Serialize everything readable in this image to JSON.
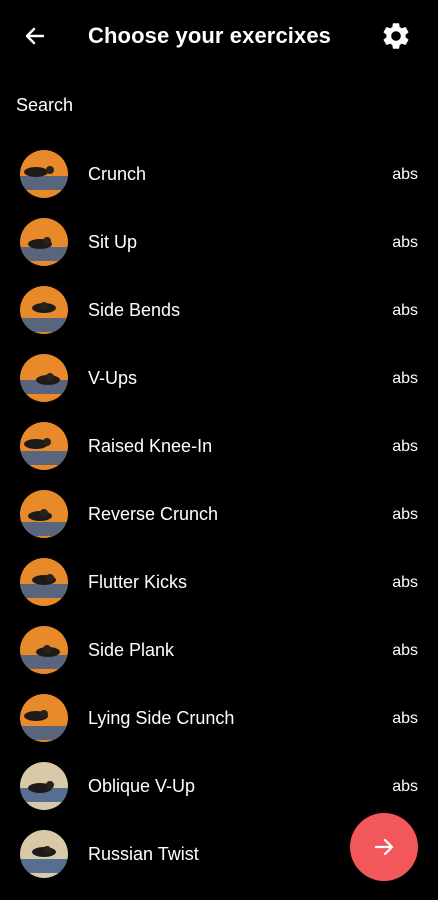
{
  "header": {
    "title": "Choose your exercixes",
    "back_icon": "arrow-left-icon",
    "settings_icon": "gear-icon"
  },
  "search": {
    "label": "Search"
  },
  "exercises": [
    {
      "name": "Crunch",
      "category": "abs",
      "thumb": "warm"
    },
    {
      "name": "Sit Up",
      "category": "abs",
      "thumb": "warm"
    },
    {
      "name": "Side Bends",
      "category": "abs",
      "thumb": "warm"
    },
    {
      "name": "V-Ups",
      "category": "abs",
      "thumb": "warm"
    },
    {
      "name": "Raised Knee-In",
      "category": "abs",
      "thumb": "warm"
    },
    {
      "name": "Reverse Crunch",
      "category": "abs",
      "thumb": "warm"
    },
    {
      "name": "Flutter Kicks",
      "category": "abs",
      "thumb": "warm"
    },
    {
      "name": "Side Plank",
      "category": "abs",
      "thumb": "warm"
    },
    {
      "name": "Lying Side Crunch",
      "category": "abs",
      "thumb": "warm"
    },
    {
      "name": "Oblique V-Up",
      "category": "abs",
      "thumb": "light"
    },
    {
      "name": "Russian Twist",
      "category": "",
      "thumb": "light"
    }
  ],
  "fab": {
    "icon": "arrow-right-icon"
  },
  "colors": {
    "background": "#000000",
    "text": "#ffffff",
    "fab": "#f2575b",
    "thumb_warm": "#e8892a",
    "thumb_light": "#d8c9a8",
    "thumb_mat": "#3f5f8c"
  }
}
